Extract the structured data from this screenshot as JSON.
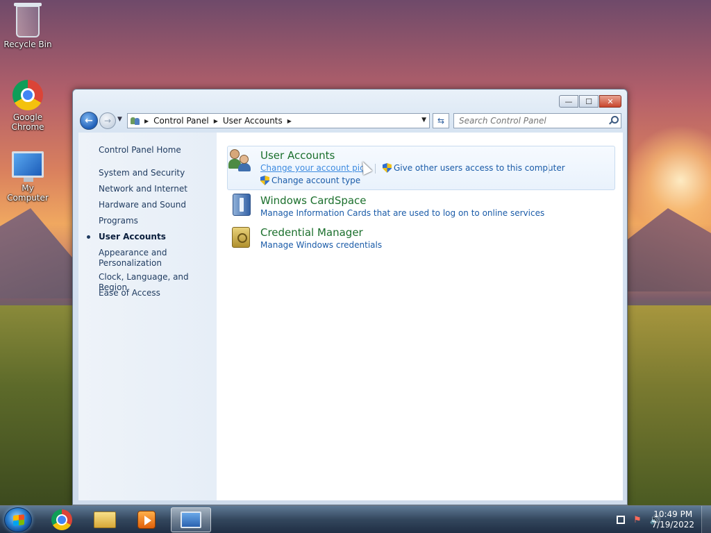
{
  "desktop": {
    "icons": [
      {
        "label": "Recycle Bin"
      },
      {
        "label": "Google Chrome"
      },
      {
        "label": "My Computer"
      }
    ]
  },
  "window": {
    "controls": {
      "minimize": "—",
      "maximize": "☐",
      "close": "✕"
    },
    "nav": {
      "back_glyph": "←",
      "forward_glyph": "→",
      "history_glyph": "▼",
      "breadcrumb": [
        "Control Panel",
        "User Accounts"
      ],
      "crumb_separator": "▶",
      "dropdown_glyph": "▼",
      "refresh_glyph": "⇆",
      "search_placeholder": "Search Control Panel"
    },
    "sidebar": {
      "items": [
        {
          "label": "Control Panel Home"
        },
        {
          "label": "System and Security"
        },
        {
          "label": "Network and Internet"
        },
        {
          "label": "Hardware and Sound"
        },
        {
          "label": "Programs"
        },
        {
          "label": "User Accounts",
          "active": true
        },
        {
          "label": "Appearance and Personalization"
        },
        {
          "label": "Clock, Language, and Region"
        },
        {
          "label": "Ease of Access"
        }
      ]
    },
    "categories": [
      {
        "title": "User Accounts",
        "links": [
          "Change your account pictu",
          "Give other users access to this computer",
          "Change account type"
        ]
      },
      {
        "title": "Windows CardSpace",
        "links": [
          "Manage Information Cards that are used to log on to online services"
        ]
      },
      {
        "title": "Credential Manager",
        "links": [
          "Manage Windows credentials"
        ]
      }
    ]
  },
  "taskbar": {
    "tray_icons": [
      "⚑",
      "🔊"
    ],
    "clock": {
      "time": "10:49 PM",
      "date": "7/19/2022"
    }
  }
}
